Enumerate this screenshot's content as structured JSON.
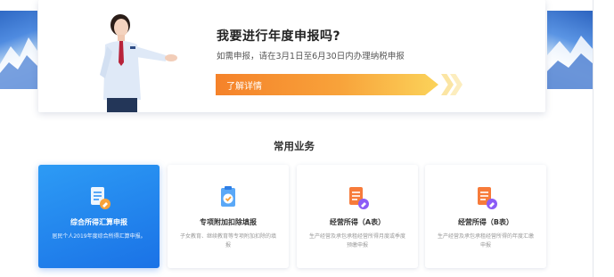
{
  "hero": {
    "title": "我要进行年度申报吗?",
    "subtitle": "如需申报，请在3月1日至6月30日内办理纳税申报",
    "cta_label": "了解详情"
  },
  "section": {
    "title": "常用业务"
  },
  "services": [
    {
      "name": "综合所得汇算申报",
      "desc": "居民个人2019年度综合所得汇算申报。",
      "icon": "document-pen-icon",
      "active": true
    },
    {
      "name": "专项附加扣除填报",
      "desc": "子女教育、继续教育等专项附加扣除的填报",
      "icon": "clipboard-check-icon",
      "active": false
    },
    {
      "name": "经营所得（A表）",
      "desc": "生产经营及承包承租经营所得月度或季度预缴申报",
      "icon": "document-pen-icon",
      "active": false
    },
    {
      "name": "经营所得（B表）",
      "desc": "生产经营及承包承租经营所得的年度汇缴申报",
      "icon": "document-pen-icon",
      "active": false
    }
  ],
  "colors": {
    "accent_blue": "#1a72e6",
    "cta_orange": "#f5822a",
    "icon_orange": "#f77b3a",
    "icon_purple": "#8b5cf6"
  }
}
